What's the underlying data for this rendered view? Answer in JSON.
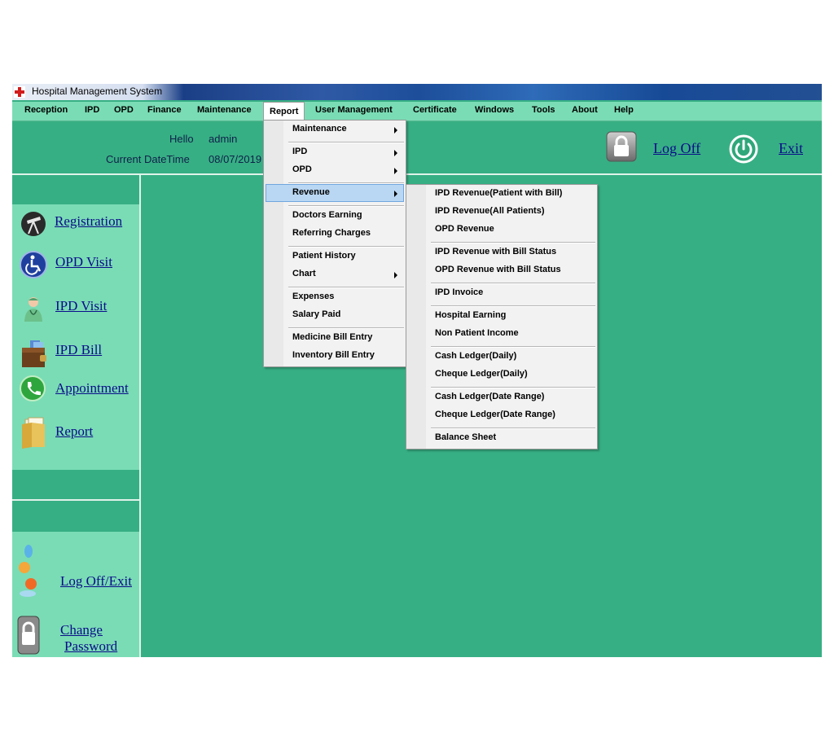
{
  "window": {
    "title": "Hospital Management System"
  },
  "menubar": {
    "items": [
      "Reception",
      "IPD",
      "OPD",
      "Finance",
      "Maintenance",
      "Report",
      "User Management",
      "Certificate",
      "Windows",
      "Tools",
      "About",
      "Help"
    ]
  },
  "header": {
    "hello_label": "Hello",
    "user": "admin",
    "datetime_label": "Current DateTime",
    "datetime_value": "08/07/2019",
    "logoff_label": "Log Off",
    "exit_label": "Exit"
  },
  "sidebar": {
    "items": [
      "Registration",
      "OPD Visit",
      "IPD Visit",
      "IPD Bill",
      "Appointment",
      "Report"
    ],
    "bottom": {
      "logoff_exit": "Log Off/Exit",
      "change": "Change",
      "password": "Password"
    }
  },
  "report_menu": {
    "items": [
      "Maintenance",
      "IPD",
      "OPD",
      "Revenue",
      "Doctors Earning",
      "Referring Charges",
      "Patient History",
      "Chart",
      "Expenses",
      "Salary Paid",
      "Medicine Bill Entry",
      "Inventory Bill Entry"
    ]
  },
  "revenue_menu": {
    "items": [
      "IPD Revenue(Patient with Bill)",
      "IPD Revenue(All Patients)",
      "OPD Revenue",
      "IPD Revenue with Bill Status",
      "OPD Revenue with Bill Status",
      "IPD Invoice",
      "Hospital Earning",
      "Non Patient Income",
      "Cash Ledger(Daily)",
      "Cheque Ledger(Daily)",
      "Cash Ledger(Date Range)",
      "Cheque Ledger(Date Range)",
      "Balance Sheet"
    ]
  },
  "colors": {
    "menubar": "#7adcb5",
    "workspace": "#37af84",
    "sidebar": "#7adcb5",
    "link": "#0b0d8a",
    "menu_highlight": "#b9d7f3"
  }
}
